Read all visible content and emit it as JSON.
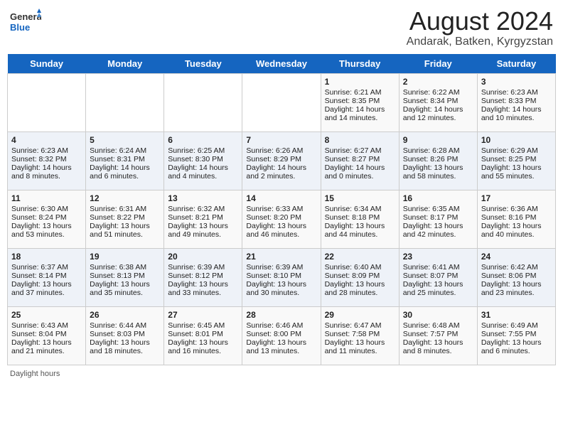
{
  "header": {
    "logo_general": "General",
    "logo_blue": "Blue",
    "month_year": "August 2024",
    "location": "Andarak, Batken, Kyrgyzstan"
  },
  "days_of_week": [
    "Sunday",
    "Monday",
    "Tuesday",
    "Wednesday",
    "Thursday",
    "Friday",
    "Saturday"
  ],
  "weeks": [
    [
      {
        "day": "",
        "info": ""
      },
      {
        "day": "",
        "info": ""
      },
      {
        "day": "",
        "info": ""
      },
      {
        "day": "",
        "info": ""
      },
      {
        "day": "1",
        "info": "Sunrise: 6:21 AM\nSunset: 8:35 PM\nDaylight: 14 hours and 14 minutes."
      },
      {
        "day": "2",
        "info": "Sunrise: 6:22 AM\nSunset: 8:34 PM\nDaylight: 14 hours and 12 minutes."
      },
      {
        "day": "3",
        "info": "Sunrise: 6:23 AM\nSunset: 8:33 PM\nDaylight: 14 hours and 10 minutes."
      }
    ],
    [
      {
        "day": "4",
        "info": "Sunrise: 6:23 AM\nSunset: 8:32 PM\nDaylight: 14 hours and 8 minutes."
      },
      {
        "day": "5",
        "info": "Sunrise: 6:24 AM\nSunset: 8:31 PM\nDaylight: 14 hours and 6 minutes."
      },
      {
        "day": "6",
        "info": "Sunrise: 6:25 AM\nSunset: 8:30 PM\nDaylight: 14 hours and 4 minutes."
      },
      {
        "day": "7",
        "info": "Sunrise: 6:26 AM\nSunset: 8:29 PM\nDaylight: 14 hours and 2 minutes."
      },
      {
        "day": "8",
        "info": "Sunrise: 6:27 AM\nSunset: 8:27 PM\nDaylight: 14 hours and 0 minutes."
      },
      {
        "day": "9",
        "info": "Sunrise: 6:28 AM\nSunset: 8:26 PM\nDaylight: 13 hours and 58 minutes."
      },
      {
        "day": "10",
        "info": "Sunrise: 6:29 AM\nSunset: 8:25 PM\nDaylight: 13 hours and 55 minutes."
      }
    ],
    [
      {
        "day": "11",
        "info": "Sunrise: 6:30 AM\nSunset: 8:24 PM\nDaylight: 13 hours and 53 minutes."
      },
      {
        "day": "12",
        "info": "Sunrise: 6:31 AM\nSunset: 8:22 PM\nDaylight: 13 hours and 51 minutes."
      },
      {
        "day": "13",
        "info": "Sunrise: 6:32 AM\nSunset: 8:21 PM\nDaylight: 13 hours and 49 minutes."
      },
      {
        "day": "14",
        "info": "Sunrise: 6:33 AM\nSunset: 8:20 PM\nDaylight: 13 hours and 46 minutes."
      },
      {
        "day": "15",
        "info": "Sunrise: 6:34 AM\nSunset: 8:18 PM\nDaylight: 13 hours and 44 minutes."
      },
      {
        "day": "16",
        "info": "Sunrise: 6:35 AM\nSunset: 8:17 PM\nDaylight: 13 hours and 42 minutes."
      },
      {
        "day": "17",
        "info": "Sunrise: 6:36 AM\nSunset: 8:16 PM\nDaylight: 13 hours and 40 minutes."
      }
    ],
    [
      {
        "day": "18",
        "info": "Sunrise: 6:37 AM\nSunset: 8:14 PM\nDaylight: 13 hours and 37 minutes."
      },
      {
        "day": "19",
        "info": "Sunrise: 6:38 AM\nSunset: 8:13 PM\nDaylight: 13 hours and 35 minutes."
      },
      {
        "day": "20",
        "info": "Sunrise: 6:39 AM\nSunset: 8:12 PM\nDaylight: 13 hours and 33 minutes."
      },
      {
        "day": "21",
        "info": "Sunrise: 6:39 AM\nSunset: 8:10 PM\nDaylight: 13 hours and 30 minutes."
      },
      {
        "day": "22",
        "info": "Sunrise: 6:40 AM\nSunset: 8:09 PM\nDaylight: 13 hours and 28 minutes."
      },
      {
        "day": "23",
        "info": "Sunrise: 6:41 AM\nSunset: 8:07 PM\nDaylight: 13 hours and 25 minutes."
      },
      {
        "day": "24",
        "info": "Sunrise: 6:42 AM\nSunset: 8:06 PM\nDaylight: 13 hours and 23 minutes."
      }
    ],
    [
      {
        "day": "25",
        "info": "Sunrise: 6:43 AM\nSunset: 8:04 PM\nDaylight: 13 hours and 21 minutes."
      },
      {
        "day": "26",
        "info": "Sunrise: 6:44 AM\nSunset: 8:03 PM\nDaylight: 13 hours and 18 minutes."
      },
      {
        "day": "27",
        "info": "Sunrise: 6:45 AM\nSunset: 8:01 PM\nDaylight: 13 hours and 16 minutes."
      },
      {
        "day": "28",
        "info": "Sunrise: 6:46 AM\nSunset: 8:00 PM\nDaylight: 13 hours and 13 minutes."
      },
      {
        "day": "29",
        "info": "Sunrise: 6:47 AM\nSunset: 7:58 PM\nDaylight: 13 hours and 11 minutes."
      },
      {
        "day": "30",
        "info": "Sunrise: 6:48 AM\nSunset: 7:57 PM\nDaylight: 13 hours and 8 minutes."
      },
      {
        "day": "31",
        "info": "Sunrise: 6:49 AM\nSunset: 7:55 PM\nDaylight: 13 hours and 6 minutes."
      }
    ]
  ],
  "footer": "Daylight hours"
}
